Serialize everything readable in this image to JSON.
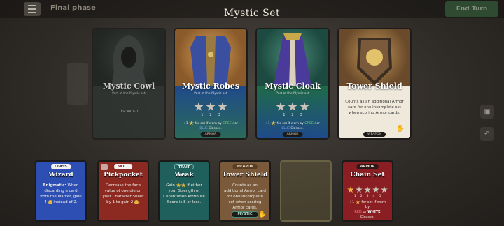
{
  "topbar": {
    "phase": "Final phase",
    "end_turn": "End Turn"
  },
  "overlay": {
    "title": "Mystic Set"
  },
  "set_cards": [
    {
      "name": "Mystic Cowl",
      "subtitle": "Part of the Mystic set",
      "status": "DISCARDED"
    },
    {
      "name": "Mystic Robes",
      "subtitle": "Part of the Mystic set",
      "star_levels": [
        "1",
        "2",
        "3"
      ],
      "bonus_prefix": "+1",
      "bonus_mid": "for set if worn by",
      "color1": "GREEN",
      "conj": "or",
      "color2": "BLUE",
      "bonus_suffix": "Classes.",
      "tag": "ARMOR"
    },
    {
      "name": "Mystic Cloak",
      "subtitle": "Part of the Mystic set",
      "star_levels": [
        "1",
        "2",
        "3"
      ],
      "bonus_prefix": "+1",
      "bonus_mid": "for set if worn by",
      "color1": "GREEN",
      "conj": "or",
      "color2": "BLUE",
      "bonus_suffix": "Classes.",
      "tag": "ARMOR"
    },
    {
      "name": "Tower Shield",
      "text": "Counts as an additional Armor card for one incomplete set when scoring Armor cards.",
      "tag": "WEAPON"
    }
  ],
  "hand": {
    "wizard": {
      "pill": "CLASS",
      "title": "Wizard",
      "kw": "Enigmatic:",
      "text_a": "When discarding a card from the Market, gain 4",
      "text_b": "instead of 2."
    },
    "pickpocket": {
      "pill": "SKILL",
      "title": "Pickpocket",
      "text_a": "Decrease the face value of one die on your Character Sheet by 1 to gain 2",
      "text_b": "."
    },
    "weak": {
      "pill": "TRAIT",
      "title": "Weak",
      "text_a": "Gain",
      "text_b": "if either your Strength or Constitution Attribute Score is 8 or less."
    },
    "tower_shield": {
      "pill": "WEAPON",
      "title": "Tower Shield",
      "text": "Counts as an additional Armor card for one incomplete set when scoring Armor cards.",
      "tag": "MYSTIC"
    },
    "chain_set": {
      "pill": "ARMOR",
      "title": "Chain Set",
      "star_levels": [
        "1",
        "2",
        "3",
        "4",
        "5"
      ],
      "bonus_prefix": "+1",
      "bonus_mid": "for set if worn by",
      "color1": "RED",
      "conj": "or",
      "color2": "WHITE",
      "bonus_suffix": "Classes."
    }
  },
  "colors": {
    "robes_bg": "#2f5aa6",
    "cloak_bg": "#2a7a52",
    "shield_bg": "#e9e3d6",
    "wizard": "#2d4fb3",
    "pickpocket": "#8c2a22",
    "weak": "#1f5f5c",
    "tower": "#7a5a3a",
    "chain": "#8a1e22"
  },
  "icons": [
    "menu-icon",
    "star-icon",
    "hand-icon",
    "coin-icon",
    "chest-icon",
    "undo-icon"
  ]
}
